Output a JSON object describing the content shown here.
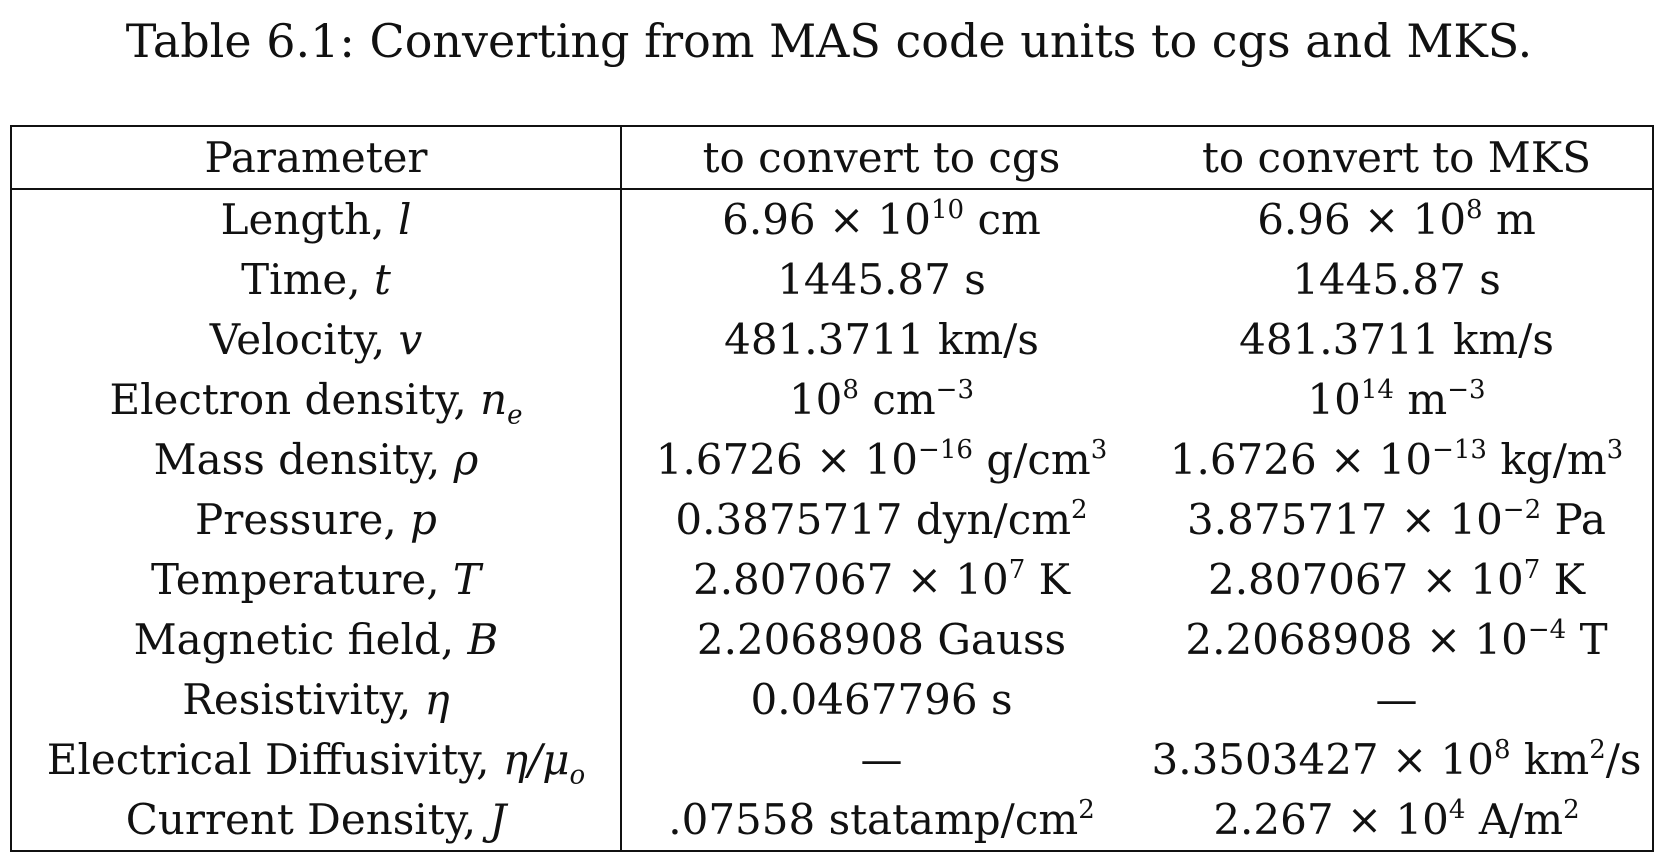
{
  "caption": "Table 6.1: Converting from MAS code units to cgs and MKS.",
  "headers": [
    "Parameter",
    "to convert to cgs",
    "to convert to MKS"
  ],
  "rows": [
    {
      "param": {
        "name": "Length,",
        "symbol": "l",
        "sub": ""
      },
      "cgs": {
        "mant": "6.96 × 10",
        "exp": "10",
        "unit": "cm",
        "uexp": "",
        "utail": ""
      },
      "mks": {
        "mant": "6.96 × 10",
        "exp": "8",
        "unit": "m",
        "uexp": "",
        "utail": ""
      }
    },
    {
      "param": {
        "name": "Time,",
        "symbol": "t",
        "sub": ""
      },
      "cgs": {
        "mant": "1445.87",
        "exp": "",
        "unit": "s",
        "uexp": "",
        "utail": ""
      },
      "mks": {
        "mant": "1445.87",
        "exp": "",
        "unit": "s",
        "uexp": "",
        "utail": ""
      }
    },
    {
      "param": {
        "name": "Velocity,",
        "symbol": "v",
        "sub": ""
      },
      "cgs": {
        "mant": "481.3711",
        "exp": "",
        "unit": "km/s",
        "uexp": "",
        "utail": ""
      },
      "mks": {
        "mant": "481.3711",
        "exp": "",
        "unit": "km/s",
        "uexp": "",
        "utail": ""
      }
    },
    {
      "param": {
        "name": "Electron density,",
        "symbol": "n",
        "sub": "e"
      },
      "cgs": {
        "mant": "10",
        "exp": "8",
        "unit": "cm",
        "uexp": "−3",
        "utail": ""
      },
      "mks": {
        "mant": "10",
        "exp": "14",
        "unit": "m",
        "uexp": "−3",
        "utail": ""
      }
    },
    {
      "param": {
        "name": "Mass density,",
        "symbol": "ρ",
        "sub": ""
      },
      "cgs": {
        "mant": "1.6726 × 10",
        "exp": "−16",
        "unit": "g/cm",
        "uexp": "3",
        "utail": ""
      },
      "mks": {
        "mant": "1.6726 × 10",
        "exp": "−13",
        "unit": "kg/m",
        "uexp": "3",
        "utail": ""
      }
    },
    {
      "param": {
        "name": "Pressure,",
        "symbol": "p",
        "sub": ""
      },
      "cgs": {
        "mant": "0.3875717",
        "exp": "",
        "unit": "dyn/cm",
        "uexp": "2",
        "utail": ""
      },
      "mks": {
        "mant": "3.875717 × 10",
        "exp": "−2",
        "unit": "Pa",
        "uexp": "",
        "utail": ""
      }
    },
    {
      "param": {
        "name": "Temperature,",
        "symbol": "T",
        "sub": ""
      },
      "cgs": {
        "mant": "2.807067 × 10",
        "exp": "7",
        "unit": "K",
        "uexp": "",
        "utail": ""
      },
      "mks": {
        "mant": "2.807067 × 10",
        "exp": "7",
        "unit": "K",
        "uexp": "",
        "utail": ""
      }
    },
    {
      "param": {
        "name": "Magnetic field,",
        "symbol": "B",
        "sub": ""
      },
      "cgs": {
        "mant": "2.2068908",
        "exp": "",
        "unit": "Gauss",
        "uexp": "",
        "utail": ""
      },
      "mks": {
        "mant": "2.2068908 × 10",
        "exp": "−4",
        "unit": "T",
        "uexp": "",
        "utail": ""
      }
    },
    {
      "param": {
        "name": "Resistivity,",
        "symbol": "η",
        "sub": ""
      },
      "cgs": {
        "mant": "0.0467796",
        "exp": "",
        "unit": "s",
        "uexp": "",
        "utail": ""
      },
      "mks": {
        "mant": "—",
        "exp": "",
        "unit": "",
        "uexp": "",
        "utail": ""
      }
    },
    {
      "param": {
        "name": "Electrical Diffusivity,",
        "symbol": "η/μ",
        "sub": "o"
      },
      "cgs": {
        "mant": "—",
        "exp": "",
        "unit": "",
        "uexp": "",
        "utail": ""
      },
      "mks": {
        "mant": "3.3503427 × 10",
        "exp": "8",
        "unit": "km",
        "uexp": "2",
        "utail": "/s"
      }
    },
    {
      "param": {
        "name": "Current Density,",
        "symbol": "J",
        "sub": ""
      },
      "cgs": {
        "mant": ".07558",
        "exp": "",
        "unit": "statamp/cm",
        "uexp": "2",
        "utail": ""
      },
      "mks": {
        "mant": "2.267 × 10",
        "exp": "4",
        "unit": "A/m",
        "uexp": "2",
        "utail": ""
      }
    }
  ]
}
